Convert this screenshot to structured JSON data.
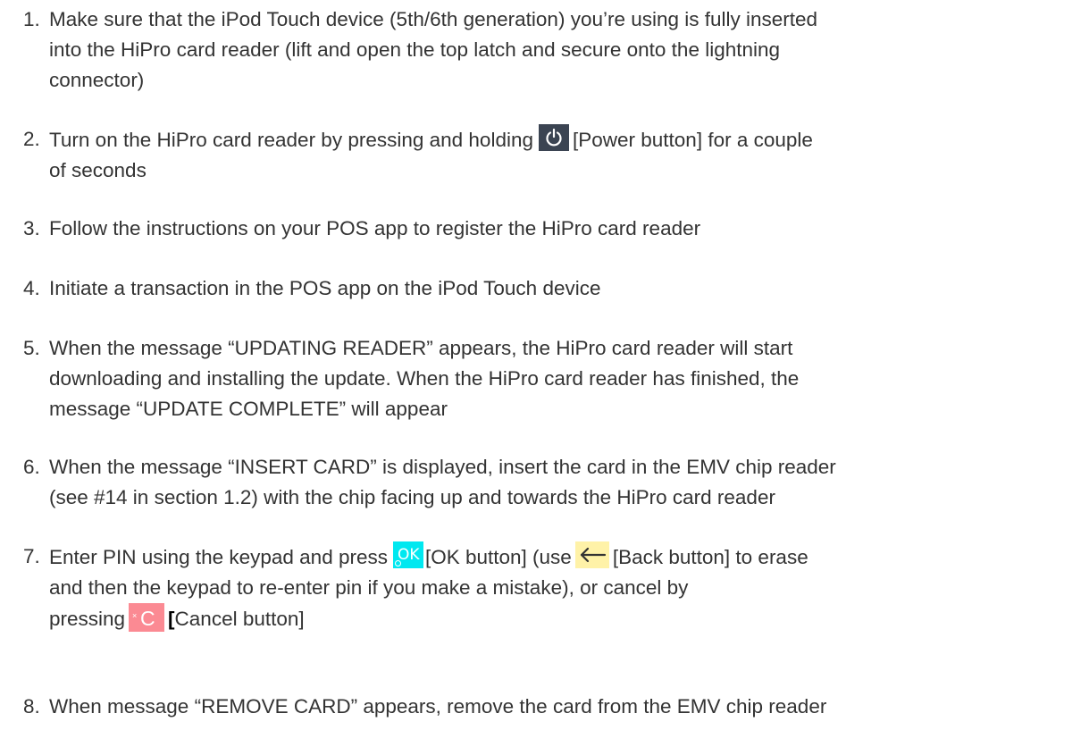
{
  "steps": [
    {
      "num": "1.",
      "lines": [
        "Make sure that the iPod Touch device (5th/6th generation) you’re using is fully inserted",
        "into the HiPro card reader (lift and open the top latch and secure onto the lightning",
        "connector)"
      ]
    },
    {
      "num": "2.",
      "before_icon": "Turn on the HiPro card reader by pressing and holding",
      "after_icon": "[Power button] for a couple",
      "line2": "of seconds"
    },
    {
      "num": "3.",
      "lines": [
        "Follow the instructions on your POS app to register the HiPro card reader"
      ]
    },
    {
      "num": "4.",
      "lines": [
        "Initiate a transaction in the POS app on the iPod Touch device"
      ]
    },
    {
      "num": "5.",
      "lines": [
        "When the message “UPDATING READER” appears, the HiPro card reader will start",
        "downloading and installing the update. When the HiPro card reader has finished, the",
        "message “UPDATE COMPLETE” will appear"
      ]
    },
    {
      "num": "6.",
      "lines": [
        "When the message “INSERT CARD” is displayed, insert the card in the EMV chip reader",
        "(see #14 in section 1.2)  with the chip facing up and towards the HiPro card reader"
      ]
    },
    {
      "num": "7.",
      "part1": "Enter PIN using the keypad and press",
      "ok_icon_text": "OK",
      "part2": "[OK button] (use",
      "part3": "[Back button] to erase",
      "line2": "and then the keypad to re-enter pin if you make a mistake), or cancel by",
      "line3_prefix": "pressing",
      "cancel_icon_text": "C",
      "cancel_icon_mark": "×",
      "line3_bracket": "[",
      "line3_suffix": "Cancel button]"
    },
    {
      "num": "8.",
      "lines": [
        "When message “REMOVE CARD” appears, remove the card from the EMV chip reader"
      ]
    }
  ],
  "icons": {
    "power": {
      "name": "power-icon",
      "color": "#3b4452"
    },
    "ok": {
      "name": "ok-button-icon",
      "color": "#00e8f0"
    },
    "back": {
      "name": "back-arrow-icon",
      "color": "#fff2a8"
    },
    "cancel": {
      "name": "cancel-button-icon",
      "color": "#fb8a93"
    }
  },
  "text_color": "#333333"
}
